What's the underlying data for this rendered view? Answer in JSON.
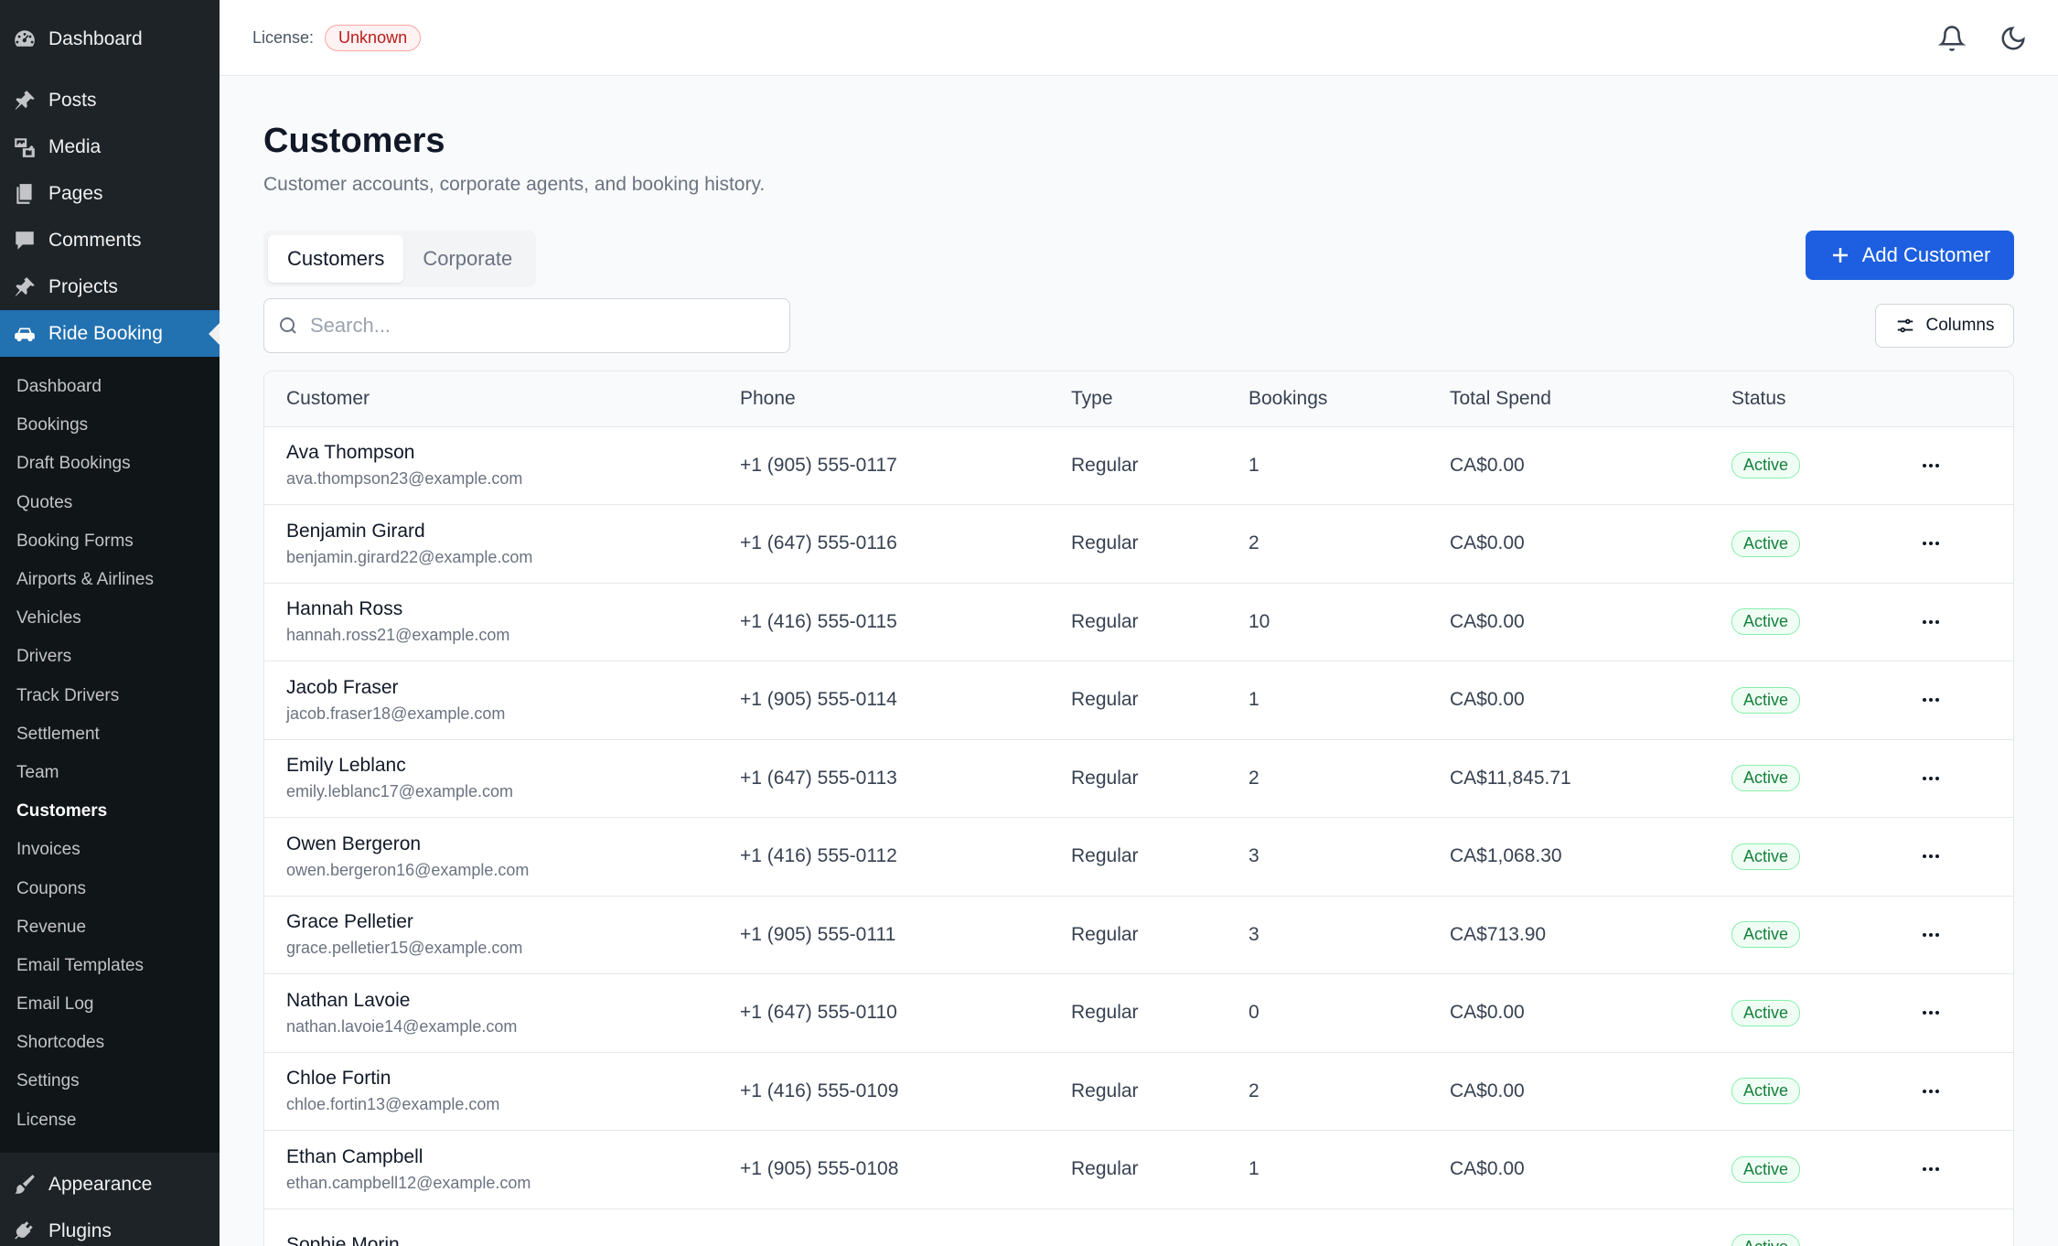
{
  "sidebar": {
    "top": [
      {
        "label": "Dashboard",
        "icon": "dashboard-icon"
      }
    ],
    "items": [
      {
        "label": "Posts",
        "icon": "pin-icon"
      },
      {
        "label": "Media",
        "icon": "media-icon"
      },
      {
        "label": "Pages",
        "icon": "pages-icon"
      },
      {
        "label": "Comments",
        "icon": "comment-icon"
      },
      {
        "label": "Projects",
        "icon": "pin-icon"
      },
      {
        "label": "Ride Booking",
        "icon": "car-icon",
        "active": true
      }
    ],
    "submenu": [
      "Dashboard",
      "Bookings",
      "Draft Bookings",
      "Quotes",
      "Booking Forms",
      "Airports & Airlines",
      "Vehicles",
      "Drivers",
      "Track Drivers",
      "Settlement",
      "Team",
      "Customers",
      "Invoices",
      "Coupons",
      "Revenue",
      "Email Templates",
      "Email Log",
      "Shortcodes",
      "Settings",
      "License"
    ],
    "submenu_current": "Customers",
    "bottom": [
      {
        "label": "Appearance",
        "icon": "brush-icon"
      },
      {
        "label": "Plugins",
        "icon": "plug-icon"
      }
    ]
  },
  "header": {
    "license_label": "License:",
    "license_status": "Unknown",
    "icons": [
      "bell-icon",
      "moon-icon"
    ]
  },
  "page": {
    "title": "Customers",
    "subtitle": "Customer accounts, corporate agents, and booking history."
  },
  "tabs": [
    {
      "label": "Customers",
      "active": true
    },
    {
      "label": "Corporate",
      "active": false
    }
  ],
  "add_button": "Add Customer",
  "search": {
    "placeholder": "Search...",
    "value": ""
  },
  "columns_button": "Columns",
  "table": {
    "headers": [
      "Customer",
      "Phone",
      "Type",
      "Bookings",
      "Total Spend",
      "Status"
    ],
    "rows": [
      {
        "name": "Ava Thompson",
        "email": "ava.thompson23@example.com",
        "phone": "+1 (905) 555-0117",
        "type": "Regular",
        "bookings": "1",
        "spend": "CA$0.00",
        "status": "Active"
      },
      {
        "name": "Benjamin Girard",
        "email": "benjamin.girard22@example.com",
        "phone": "+1 (647) 555-0116",
        "type": "Regular",
        "bookings": "2",
        "spend": "CA$0.00",
        "status": "Active"
      },
      {
        "name": "Hannah Ross",
        "email": "hannah.ross21@example.com",
        "phone": "+1 (416) 555-0115",
        "type": "Regular",
        "bookings": "10",
        "spend": "CA$0.00",
        "status": "Active"
      },
      {
        "name": "Jacob Fraser",
        "email": "jacob.fraser18@example.com",
        "phone": "+1 (905) 555-0114",
        "type": "Regular",
        "bookings": "1",
        "spend": "CA$0.00",
        "status": "Active"
      },
      {
        "name": "Emily Leblanc",
        "email": "emily.leblanc17@example.com",
        "phone": "+1 (647) 555-0113",
        "type": "Regular",
        "bookings": "2",
        "spend": "CA$11,845.71",
        "status": "Active"
      },
      {
        "name": "Owen Bergeron",
        "email": "owen.bergeron16@example.com",
        "phone": "+1 (416) 555-0112",
        "type": "Regular",
        "bookings": "3",
        "spend": "CA$1,068.30",
        "status": "Active"
      },
      {
        "name": "Grace Pelletier",
        "email": "grace.pelletier15@example.com",
        "phone": "+1 (905) 555-0111",
        "type": "Regular",
        "bookings": "3",
        "spend": "CA$713.90",
        "status": "Active"
      },
      {
        "name": "Nathan Lavoie",
        "email": "nathan.lavoie14@example.com",
        "phone": "+1 (647) 555-0110",
        "type": "Regular",
        "bookings": "0",
        "spend": "CA$0.00",
        "status": "Active"
      },
      {
        "name": "Chloe Fortin",
        "email": "chloe.fortin13@example.com",
        "phone": "+1 (416) 555-0109",
        "type": "Regular",
        "bookings": "2",
        "spend": "CA$0.00",
        "status": "Active"
      },
      {
        "name": "Ethan Campbell",
        "email": "ethan.campbell12@example.com",
        "phone": "+1 (905) 555-0108",
        "type": "Regular",
        "bookings": "1",
        "spend": "CA$0.00",
        "status": "Active"
      },
      {
        "name": "Sophie Morin",
        "email": "",
        "phone": "",
        "type": "",
        "bookings": "",
        "spend": "",
        "status": "Active"
      }
    ]
  }
}
